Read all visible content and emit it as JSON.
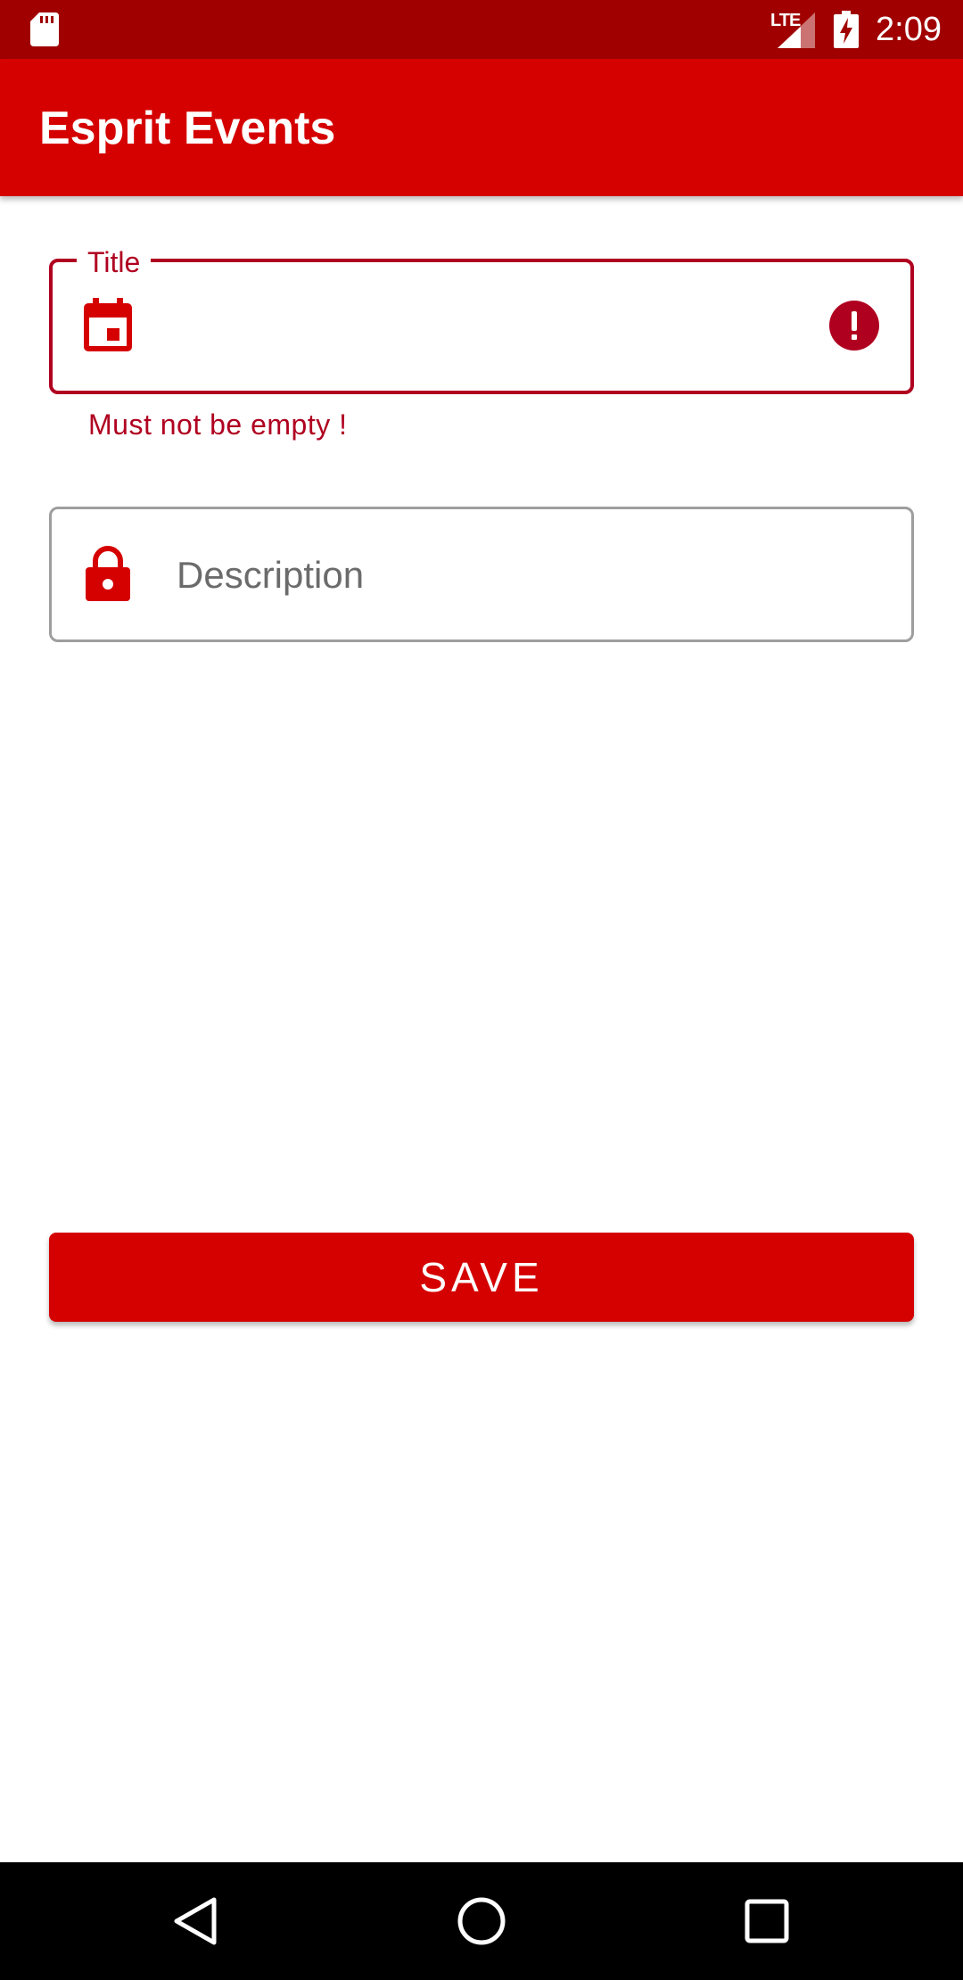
{
  "status_bar": {
    "network": "LTE",
    "time": "2:09",
    "icons": [
      "sd-card-icon",
      "signal-icon",
      "battery-charging-icon"
    ]
  },
  "app_bar": {
    "title": "Esprit Events"
  },
  "form": {
    "title_field": {
      "label": "Title",
      "value": "",
      "error": "Must not be empty !",
      "leading_icon": "calendar-icon",
      "trailing_icon": "error-icon"
    },
    "description_field": {
      "placeholder": "Description",
      "value": "",
      "leading_icon": "lock-icon"
    },
    "save_label": "SAVE"
  },
  "nav_bar": {
    "buttons": [
      "back-icon",
      "home-icon",
      "recents-icon"
    ]
  },
  "colors": {
    "status_bar": "#a00000",
    "primary": "#d50000",
    "error": "#b00020",
    "outline": "#9e9e9e",
    "nav_bar": "#000000"
  }
}
